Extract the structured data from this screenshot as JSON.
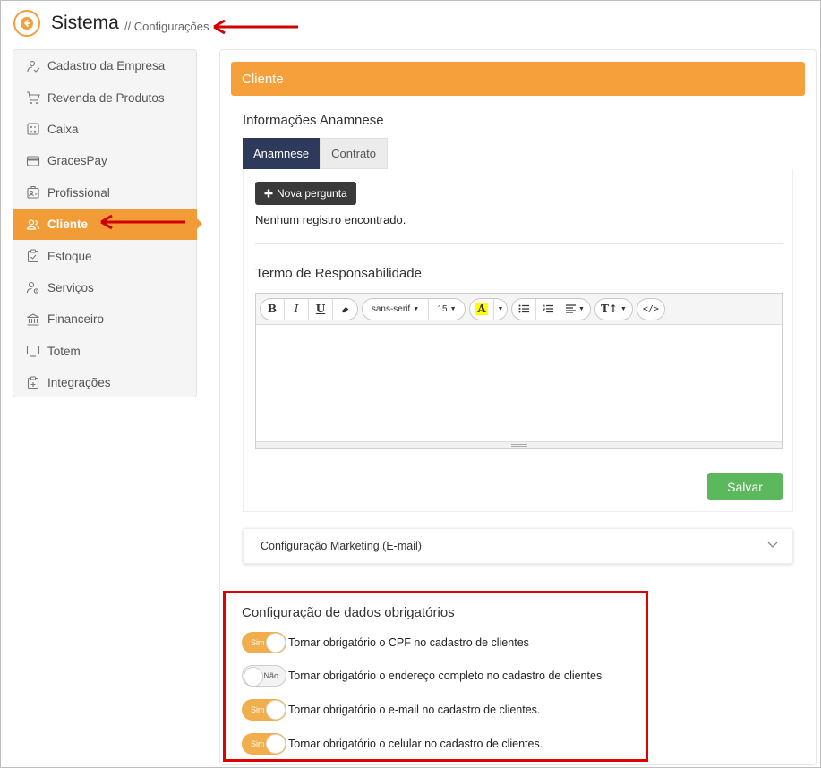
{
  "header": {
    "title": "Sistema",
    "breadcrumb": "// Configurações"
  },
  "sidebar": {
    "items": [
      {
        "label": "Cadastro da Empresa",
        "icon": "user-check-icon"
      },
      {
        "label": "Revenda de Produtos",
        "icon": "cart-icon"
      },
      {
        "label": "Caixa",
        "icon": "calculator-icon"
      },
      {
        "label": "GracesPay",
        "icon": "credit-card-icon"
      },
      {
        "label": "Profissional",
        "icon": "id-badge-icon"
      },
      {
        "label": "Cliente",
        "icon": "users-icon",
        "active": true
      },
      {
        "label": "Estoque",
        "icon": "clipboard-icon"
      },
      {
        "label": "Serviços",
        "icon": "user-gear-icon"
      },
      {
        "label": "Financeiro",
        "icon": "bank-icon"
      },
      {
        "label": "Totem",
        "icon": "monitor-icon"
      },
      {
        "label": "Integrações",
        "icon": "plug-clipboard-icon"
      }
    ]
  },
  "card": {
    "title": "Cliente",
    "anamnese_title": "Informações Anamnese",
    "tabs": [
      {
        "label": "Anamnese",
        "active": true
      },
      {
        "label": "Contrato",
        "active": false
      }
    ],
    "new_button": "Nova pergunta",
    "empty_text": "Nenhum registro encontrado.",
    "term_title": "Termo de Responsabilidade",
    "editor": {
      "font_family": "sans-serif",
      "font_size": "15"
    },
    "save_label": "Salvar",
    "accordion_label": "Configuração Marketing (E-mail)"
  },
  "required": {
    "title": "Configuração de dados obrigatórios",
    "rows": [
      {
        "state": "Sim",
        "on": true,
        "label": "Tornar obrigatório o CPF no cadastro de clientes"
      },
      {
        "state": "Não",
        "on": false,
        "label": "Tornar obrigatório o endereço completo no cadastro de clientes"
      },
      {
        "state": "Sim",
        "on": true,
        "label": "Tornar obrigatório o e-mail no cadastro de clientes."
      },
      {
        "state": "Sim",
        "on": true,
        "label": "Tornar obrigatório o celular no cadastro de clientes."
      }
    ]
  },
  "colors": {
    "accent": "#f29c38",
    "tab_active": "#2d3a5c",
    "save": "#5cb85c",
    "highlight": "#e00000"
  }
}
